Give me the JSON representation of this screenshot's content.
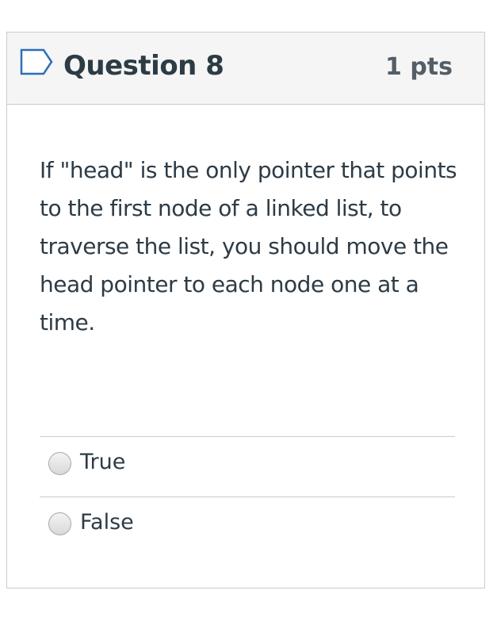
{
  "question": {
    "title": "Question 8",
    "points": "1 pts",
    "flag_icon": "flag-outline-icon",
    "text": "If \"head\" is the only pointer that points to the first node of a linked list, to traverse the list, you should move the head pointer to each node one at a time.",
    "answers": [
      {
        "label": "True",
        "selected": false
      },
      {
        "label": "False",
        "selected": false
      }
    ]
  },
  "colors": {
    "text": "#2d3b45",
    "points_text": "#555e66",
    "header_background": "#f5f5f5",
    "border": "#c7cdd1",
    "flag_stroke": "#2d6fb7"
  }
}
